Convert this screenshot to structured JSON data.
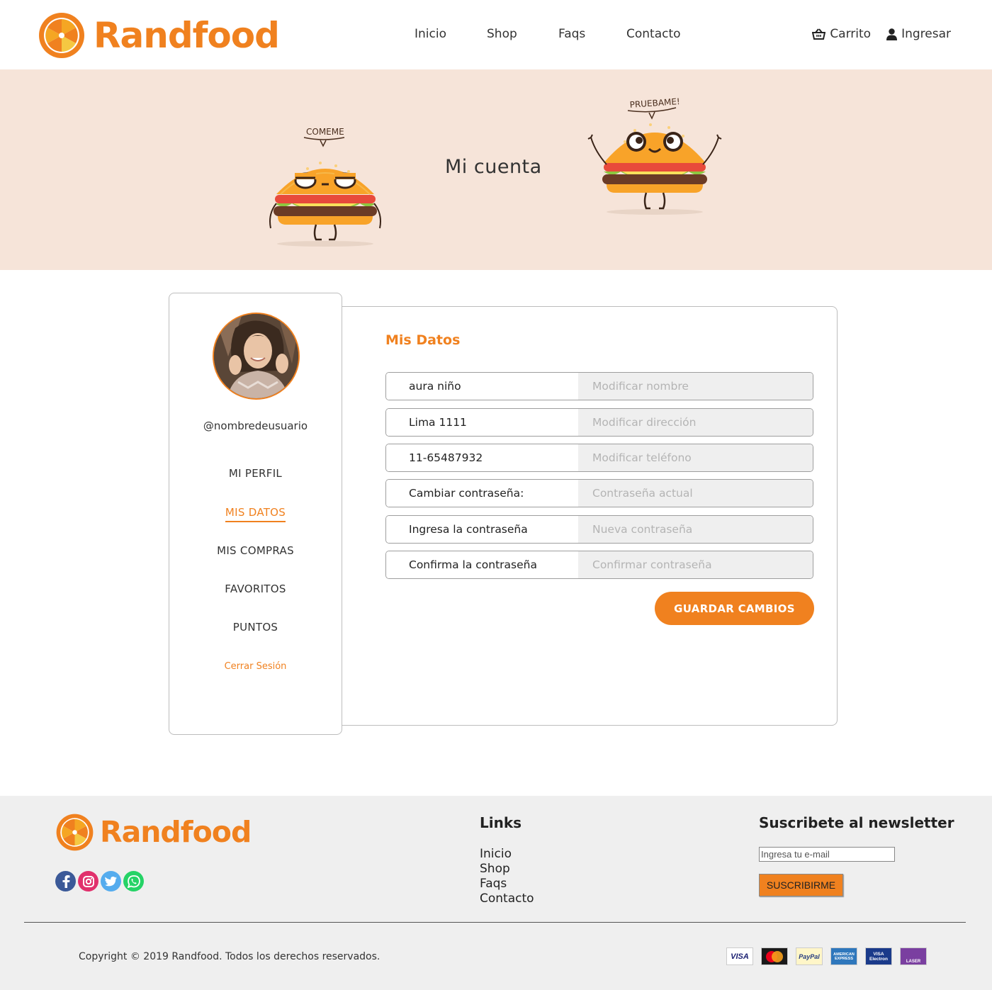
{
  "brand": {
    "name": "Randfood",
    "accent": "#f0811f"
  },
  "nav": {
    "items": [
      {
        "label": "Inicio"
      },
      {
        "label": "Shop"
      },
      {
        "label": "Faqs"
      },
      {
        "label": "Contacto"
      }
    ],
    "cart_label": "Carrito",
    "login_label": "Ingresar"
  },
  "hero": {
    "title": "Mi cuenta",
    "bubble_left": "COMEME",
    "bubble_right": "PRUEBAME!"
  },
  "sidebar": {
    "username": "@nombredeusuario",
    "items": [
      {
        "label": "MI PERFIL",
        "active": false
      },
      {
        "label": "MIS DATOS",
        "active": true
      },
      {
        "label": "MIS COMPRAS",
        "active": false
      },
      {
        "label": "FAVORITOS",
        "active": false
      },
      {
        "label": "PUNTOS",
        "active": false
      }
    ],
    "logout_label": "Cerrar Sesión"
  },
  "form": {
    "title": "Mis Datos",
    "fields": [
      {
        "label": "aura niño",
        "placeholder": "Modificar nombre"
      },
      {
        "label": "Lima 1111",
        "placeholder": "Modificar dirección"
      },
      {
        "label": "11-65487932",
        "placeholder": "Modificar teléfono"
      },
      {
        "label": "Cambiar contraseña:",
        "placeholder": "Contraseña actual"
      },
      {
        "label": "Ingresa la contraseña",
        "placeholder": "Nueva contraseña"
      },
      {
        "label": "Confirma la contraseña",
        "placeholder": "Confirmar contraseña"
      }
    ],
    "save_label": "GUARDAR CAMBIOS"
  },
  "footer": {
    "links_title": "Links",
    "links": [
      "Inicio",
      "Shop",
      "Faqs",
      "Contacto"
    ],
    "newsletter_title": "Suscribete al newsletter",
    "newsletter_placeholder": "Ingresa tu e-mail",
    "subscribe_label": "SUSCRIBIRME",
    "copyright": "Copyright © 2019 Randfood. Todos los derechos reservados.",
    "social_icons": [
      "facebook-icon",
      "instagram-icon",
      "twitter-icon",
      "whatsapp-icon"
    ],
    "payment_cards": [
      {
        "label": "VISA"
      },
      {
        "label": "Mastercard"
      },
      {
        "label": "PayPal"
      },
      {
        "label": "AMERICAN EXPRESS"
      },
      {
        "label": "VISA Electron"
      },
      {
        "label": "LASER"
      }
    ]
  }
}
